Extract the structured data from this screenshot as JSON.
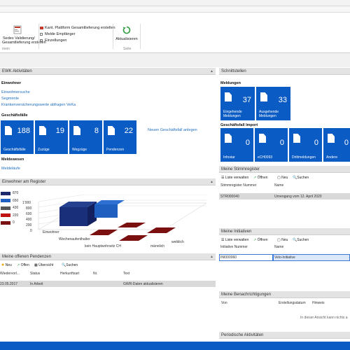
{
  "ribbon": {
    "validate_line1": "Sedes Validierung/",
    "validate_line2": "Gesamtlieferung erstellen",
    "group_left": "mein",
    "kant_platform": "Kant. Plattform Gesamtlieferung erstellen",
    "meldeempfaenger": "Melde Empfänger",
    "einzellungen": "Einzellungen",
    "refresh_label": "Aktualisieren",
    "group_right": "Seite"
  },
  "ewk": {
    "title": "EWK Aktivitäten",
    "einwohner_head": "Einwohner",
    "links": [
      "Einwohnersuche",
      "Segmente",
      "Krankenversicherungswerte abfragen VeKa"
    ],
    "geschaeftsfaelle_head": "Geschäftsfälle",
    "tiles": [
      {
        "label": "Geschäftsfälle",
        "count": "188"
      },
      {
        "label": "Zuzüge",
        "count": "19"
      },
      {
        "label": "Wegzüge",
        "count": "8"
      },
      {
        "label": "Pendenzen",
        "count": "22"
      }
    ],
    "new_case_link": "Neuen Geschäftsfall anlegen",
    "meldewesen_head": "Meldewesen",
    "meldelaeufe_link": "Meldeläufe"
  },
  "register": {
    "title": "Einwohner am Register",
    "legend": [
      {
        "value": "870",
        "color": "#1a2a6c"
      },
      {
        "value": "650",
        "color": "#1f5fbf"
      },
      {
        "value": "430",
        "color": "#555555"
      },
      {
        "value": "220",
        "color": "#c01010"
      },
      {
        "value": "0",
        "color": "#7a1010"
      }
    ],
    "y_ticks": [
      "1'000",
      "800",
      "600",
      "400",
      "200",
      "0"
    ],
    "x_labels": [
      "Einwohner",
      "Wochenaufenthalter",
      "kein Hauptwohnsitz CH"
    ],
    "z_labels": [
      "weiblich",
      "männlich"
    ]
  },
  "pendenzen": {
    "title": "Meine offenen Pendenzen",
    "toolbar": [
      "Neu",
      "Offen",
      "Übersicht",
      "Suchen"
    ],
    "headers": [
      "Wiedervorl...",
      "Status",
      "Herkunftsart",
      "Nr.",
      "Text"
    ],
    "row": {
      "date": "23.05.2017",
      "status": "In Arbeit",
      "text": "GWR-Daten aktualisieren"
    }
  },
  "schnittstellen": {
    "title": "Schnittstellen",
    "meldungen_head": "Meldungen",
    "tiles": [
      {
        "label": "Eingehende Meldungen",
        "count": "37"
      },
      {
        "label": "Ausgehende Meldungen",
        "count": "33"
      }
    ],
    "import_head": "Geschäftsfall Import",
    "import_tiles": [
      {
        "label": "Infostar",
        "count": "0"
      },
      {
        "label": "eCH0093",
        "count": "0"
      },
      {
        "label": "Drittmeldungen",
        "count": "0"
      },
      {
        "label": "Andere",
        "count": "0"
      }
    ]
  },
  "stimmregister": {
    "title": "Meine Stimmregister",
    "toolbar": [
      "Liste verwalten",
      "Öffnen",
      "Neu",
      "Suchen"
    ],
    "headers": [
      "Stimmregister Nummer",
      "Name"
    ],
    "row": {
      "nummer": "STR000040",
      "name": "Urnengang vom 12. April 2020"
    }
  },
  "initiativen": {
    "title": "Meine Initiativen",
    "toolbar": [
      "Liste verwalten",
      "Öffnen",
      "Neu",
      "Suchen"
    ],
    "headers": [
      "Initiative Nummer",
      "Name"
    ],
    "row": {
      "nummer": "INI000060",
      "name": "Velo-Initiative"
    }
  },
  "benachrichtigungen": {
    "title": "Meine Benachrichtigungen",
    "headers": [
      "Von",
      "Erstellungsdatum",
      "Hinweis"
    ],
    "empty": "In dieser Ansicht kann nichts a"
  },
  "periodische": {
    "title": "Periodische Aktivitäten"
  }
}
